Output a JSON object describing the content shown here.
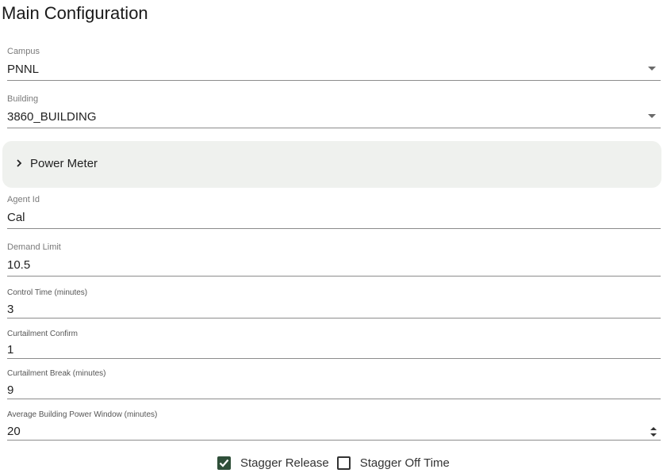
{
  "page": {
    "title": "Main Configuration"
  },
  "fields": {
    "campus": {
      "label": "Campus",
      "value": "PNNL"
    },
    "building": {
      "label": "Building",
      "value": "3860_BUILDING"
    },
    "agent_id": {
      "label": "Agent Id",
      "value": "Cal"
    },
    "demand_limit": {
      "label": "Demand Limit",
      "value": "10.5"
    },
    "control_time": {
      "label": "Control Time (minutes)",
      "value": "3"
    },
    "curtailment_confirm": {
      "label": "Curtailment Confirm",
      "value": "1"
    },
    "curtailment_break": {
      "label": "Curtailment Break (minutes)",
      "value": "9"
    },
    "avg_power_window": {
      "label": "Average Building Power Window (minutes)",
      "value": "20"
    }
  },
  "accordion": {
    "label": "Power Meter",
    "expanded": false
  },
  "checkboxes": {
    "stagger_release": {
      "label": "Stagger Release",
      "checked": true
    },
    "stagger_off_time": {
      "label": "Stagger Off Time",
      "checked": false
    }
  },
  "colors": {
    "accent": "#2f4f39",
    "accordion_bg": "#eff1ee",
    "underline": "#8c8c8c"
  }
}
